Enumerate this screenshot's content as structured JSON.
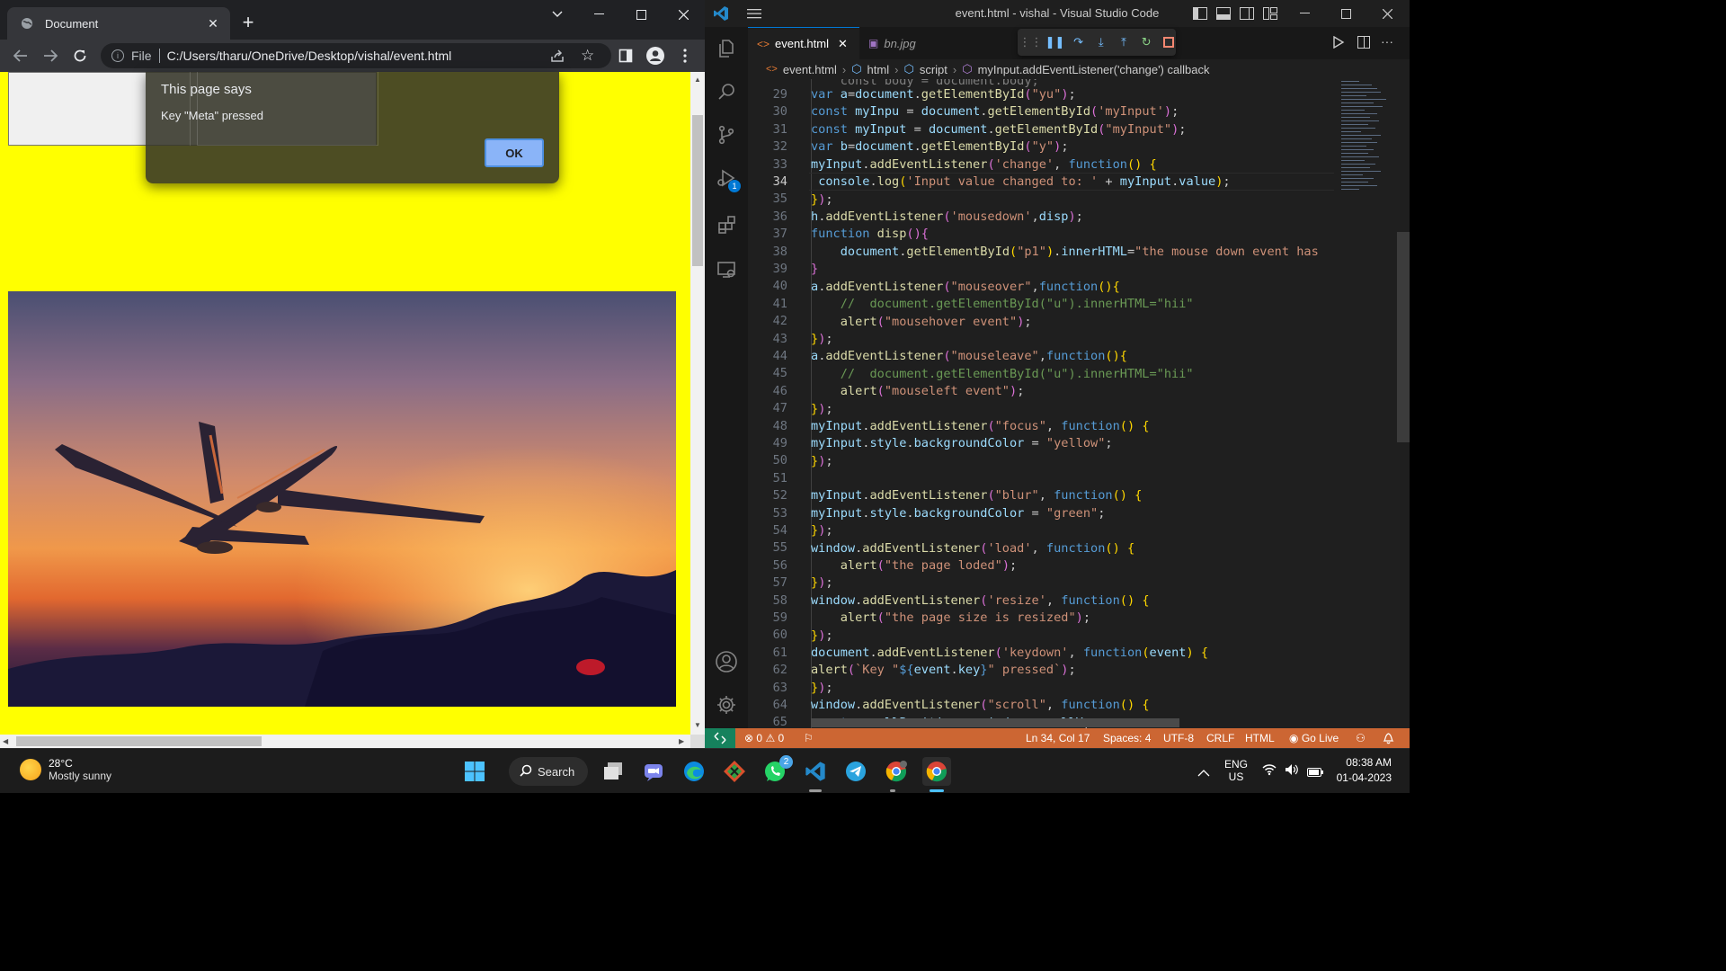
{
  "chrome": {
    "tab_title": "Document",
    "url_scheme": "File",
    "url": "C:/Users/tharu/OneDrive/Desktop/vishal/event.html",
    "dialog": {
      "title": "This page says",
      "message": "Key \"Meta\" pressed",
      "ok_label": "OK"
    },
    "page_background": "#ffff00"
  },
  "vscode": {
    "title": "event.html - vishal - Visual Studio Code",
    "tabs": [
      {
        "label": "event.html",
        "active": true
      },
      {
        "label": "bn.jpg",
        "active": false
      }
    ],
    "breadcrumb": [
      "event.html",
      "html",
      "script",
      "myInput.addEventListener('change') callback"
    ],
    "debug_badge": "1",
    "current_line": "34",
    "lines": [
      {
        "n": "29"
      },
      {
        "n": "30"
      },
      {
        "n": "31"
      },
      {
        "n": "32"
      },
      {
        "n": "33"
      },
      {
        "n": "34"
      },
      {
        "n": "35"
      },
      {
        "n": "36"
      },
      {
        "n": "37"
      },
      {
        "n": "38"
      },
      {
        "n": "39"
      },
      {
        "n": "40"
      },
      {
        "n": "41"
      },
      {
        "n": "42"
      },
      {
        "n": "43"
      },
      {
        "n": "44"
      },
      {
        "n": "45"
      },
      {
        "n": "46"
      },
      {
        "n": "47"
      },
      {
        "n": "48"
      },
      {
        "n": "49"
      },
      {
        "n": "50"
      },
      {
        "n": "51"
      },
      {
        "n": "52"
      },
      {
        "n": "53"
      },
      {
        "n": "54"
      },
      {
        "n": "55"
      },
      {
        "n": "56"
      },
      {
        "n": "57"
      },
      {
        "n": "58"
      },
      {
        "n": "59"
      },
      {
        "n": "60"
      },
      {
        "n": "61"
      },
      {
        "n": "62"
      },
      {
        "n": "63"
      },
      {
        "n": "64"
      },
      {
        "n": "65"
      }
    ],
    "status": {
      "errors": "0",
      "warnings": "0",
      "position": "Ln 34, Col 17",
      "spaces": "Spaces: 4",
      "encoding": "UTF-8",
      "eol": "CRLF",
      "language": "HTML",
      "golive": "Go Live"
    },
    "statusbar_color": "#cc6633"
  },
  "taskbar": {
    "temperature": "28°C",
    "weather": "Mostly sunny",
    "search_label": "Search",
    "whatsapp_badge": "2",
    "lang1": "ENG",
    "lang2": "US",
    "time": "08:38 AM",
    "date": "01-04-2023"
  }
}
